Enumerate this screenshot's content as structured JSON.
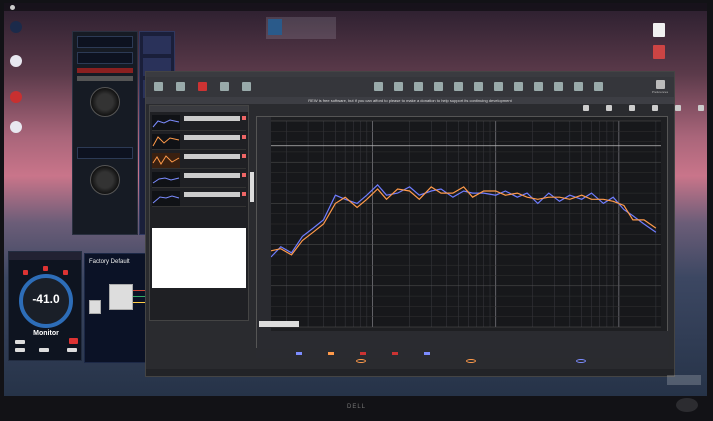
{
  "menubar": {
    "items": [
      "",
      "",
      "",
      "",
      "",
      ""
    ],
    "right": [
      "",
      "",
      ""
    ]
  },
  "desktop": {
    "left_icons": [
      "",
      "",
      "",
      ""
    ],
    "right_icons": [
      "",
      "",
      "",
      "",
      "",
      ""
    ]
  },
  "monitor": {
    "brand": "DELL"
  },
  "controller": {
    "header": "",
    "value": "-41.0",
    "label": "Monitor"
  },
  "factory": {
    "title": "Factory Default"
  },
  "rew": {
    "donate_text_before": "REW is free software, but if you can afford to please",
    "donate_link": "",
    "donate_text_after": "to make a donation to help support its continuing development",
    "toolbar": [
      "",
      "",
      "",
      "",
      ""
    ],
    "center_tools": [
      "",
      "",
      "",
      "",
      "",
      "",
      "",
      "",
      "",
      "",
      "",
      ""
    ],
    "preferences": "Preferences",
    "graph_tabs": [
      "",
      "",
      "",
      "",
      "",
      ""
    ],
    "measurements": [
      {
        "name": "",
        "color": "#7c8cff"
      },
      {
        "name": "",
        "color": "#ff9a4a"
      },
      {
        "name": "",
        "color": "#ff9a4a"
      },
      {
        "name": "",
        "color": "#7c8cff"
      },
      {
        "name": "",
        "color": "#7c8cff"
      }
    ],
    "status": [
      "",
      "",
      "",
      "",
      ""
    ],
    "legend": [
      "",
      "",
      "",
      "",
      "",
      "",
      ""
    ]
  },
  "chart_data": {
    "type": "line",
    "title": "",
    "xlabel": "",
    "ylabel": "",
    "xscale": "log",
    "xlim": [
      15,
      22000
    ],
    "ylim": [
      0,
      10
    ],
    "grid": true,
    "series": [
      {
        "color": "#6f7dff",
        "x": [
          15,
          18,
          22,
          27,
          33,
          40,
          50,
          60,
          75,
          90,
          110,
          130,
          160,
          200,
          240,
          300,
          360,
          450,
          550,
          650,
          800,
          1000,
          1200,
          1500,
          1800,
          2200,
          2700,
          3300,
          4000,
          5000,
          6000,
          7500,
          9000,
          11000,
          13000,
          16000,
          20000
        ],
        "y": [
          3.4,
          3.9,
          3.6,
          4.4,
          4.8,
          5.2,
          6.4,
          6.2,
          6.0,
          6.4,
          6.9,
          6.4,
          6.5,
          6.8,
          6.4,
          6.6,
          6.7,
          6.3,
          6.6,
          6.5,
          6.5,
          6.4,
          6.6,
          6.3,
          6.5,
          6.0,
          6.5,
          6.1,
          6.4,
          6.2,
          6.5,
          6.0,
          6.3,
          5.7,
          5.4,
          5.0,
          4.6
        ]
      },
      {
        "color": "#ff9a4a",
        "x": [
          15,
          18,
          22,
          27,
          33,
          40,
          50,
          60,
          75,
          90,
          110,
          130,
          160,
          200,
          240,
          300,
          360,
          450,
          550,
          650,
          800,
          1000,
          1200,
          1500,
          1800,
          2200,
          2700,
          3300,
          4000,
          5000,
          6000,
          7500,
          9000,
          11000,
          13000,
          16000,
          20000
        ],
        "y": [
          3.7,
          3.8,
          3.5,
          4.2,
          4.6,
          5.0,
          6.0,
          6.3,
          5.8,
          6.2,
          6.7,
          6.2,
          6.7,
          6.6,
          6.2,
          6.8,
          6.5,
          6.5,
          6.8,
          6.3,
          6.6,
          6.6,
          6.4,
          6.5,
          6.3,
          6.2,
          6.3,
          6.3,
          6.2,
          6.4,
          6.2,
          6.2,
          6.1,
          5.9,
          5.2,
          5.2,
          4.8
        ]
      }
    ]
  }
}
